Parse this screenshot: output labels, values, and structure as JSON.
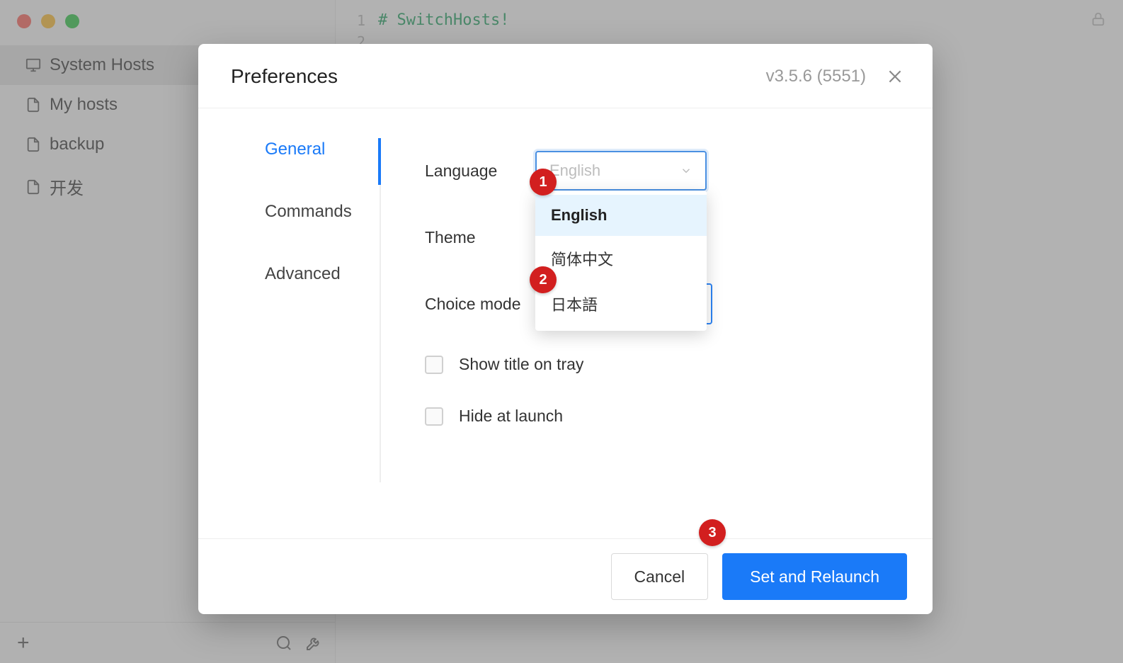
{
  "sidebar": {
    "items": [
      {
        "label": "System Hosts",
        "icon": "monitor"
      },
      {
        "label": "My hosts",
        "icon": "file"
      },
      {
        "label": "backup",
        "icon": "file"
      },
      {
        "label": "开发",
        "icon": "file"
      }
    ]
  },
  "editor": {
    "line1_number": "1",
    "line2_number": "2",
    "line1_text": "# SwitchHosts!"
  },
  "modal": {
    "title": "Preferences",
    "version": "v3.5.6 (5551)",
    "tabs": {
      "general": "General",
      "commands": "Commands",
      "advanced": "Advanced"
    },
    "fields": {
      "language_label": "Language",
      "language_value": "English",
      "theme_label": "Theme",
      "choice_mode_label": "Choice mode",
      "show_title_label": "Show title on tray",
      "hide_launch_label": "Hide at launch"
    },
    "language_options": [
      "English",
      "简体中文",
      "日本語"
    ],
    "footer": {
      "cancel": "Cancel",
      "set_relaunch": "Set and Relaunch"
    }
  },
  "annotations": {
    "b1": "1",
    "b2": "2",
    "b3": "3"
  }
}
